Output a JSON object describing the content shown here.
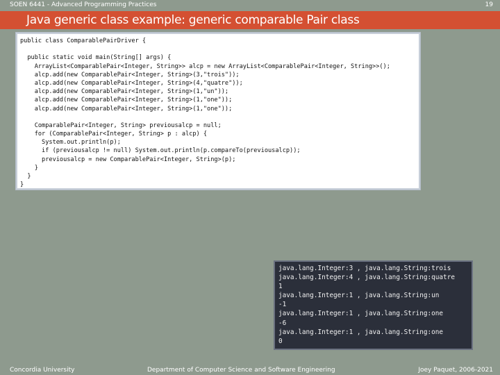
{
  "header": {
    "course": "SOEN 6441 - Advanced Programming Practices",
    "page_number": "19"
  },
  "slide": {
    "title": "Java generic class example: generic comparable Pair class"
  },
  "code_lines": [
    "public class ComparablePairDriver {",
    "",
    "  public static void main(String[] args) {",
    "    ArrayList<ComparablePair<Integer, String>> alcp = new ArrayList<ComparablePair<Integer, String>>();",
    "    alcp.add(new ComparablePair<Integer, String>(3,\"trois\"));",
    "    alcp.add(new ComparablePair<Integer, String>(4,\"quatre\"));",
    "    alcp.add(new ComparablePair<Integer, String>(1,\"un\"));",
    "    alcp.add(new ComparablePair<Integer, String>(1,\"one\"));",
    "    alcp.add(new ComparablePair<Integer, String>(1,\"one\"));",
    "",
    "    ComparablePair<Integer, String> previousalcp = null;",
    "    for (ComparablePair<Integer, String> p : alcp) {",
    "      System.out.println(p);",
    "      if (previousalcp != null) System.out.println(p.compareTo(previousalcp));",
    "      previousalcp = new ComparablePair<Integer, String>(p);",
    "    }",
    "  }",
    "}"
  ],
  "output_lines": [
    "java.lang.Integer:3 , java.lang.String:trois",
    "java.lang.Integer:4 , java.lang.String:quatre",
    "1",
    "java.lang.Integer:1 , java.lang.String:un",
    "-1",
    "java.lang.Integer:1 , java.lang.String:one",
    "-6",
    "java.lang.Integer:1 , java.lang.String:one",
    "0"
  ],
  "footer": {
    "left": "Concordia University",
    "center": "Department of Computer Science and Software Engineering",
    "right": "Joey Paquet, 2006-2021"
  }
}
